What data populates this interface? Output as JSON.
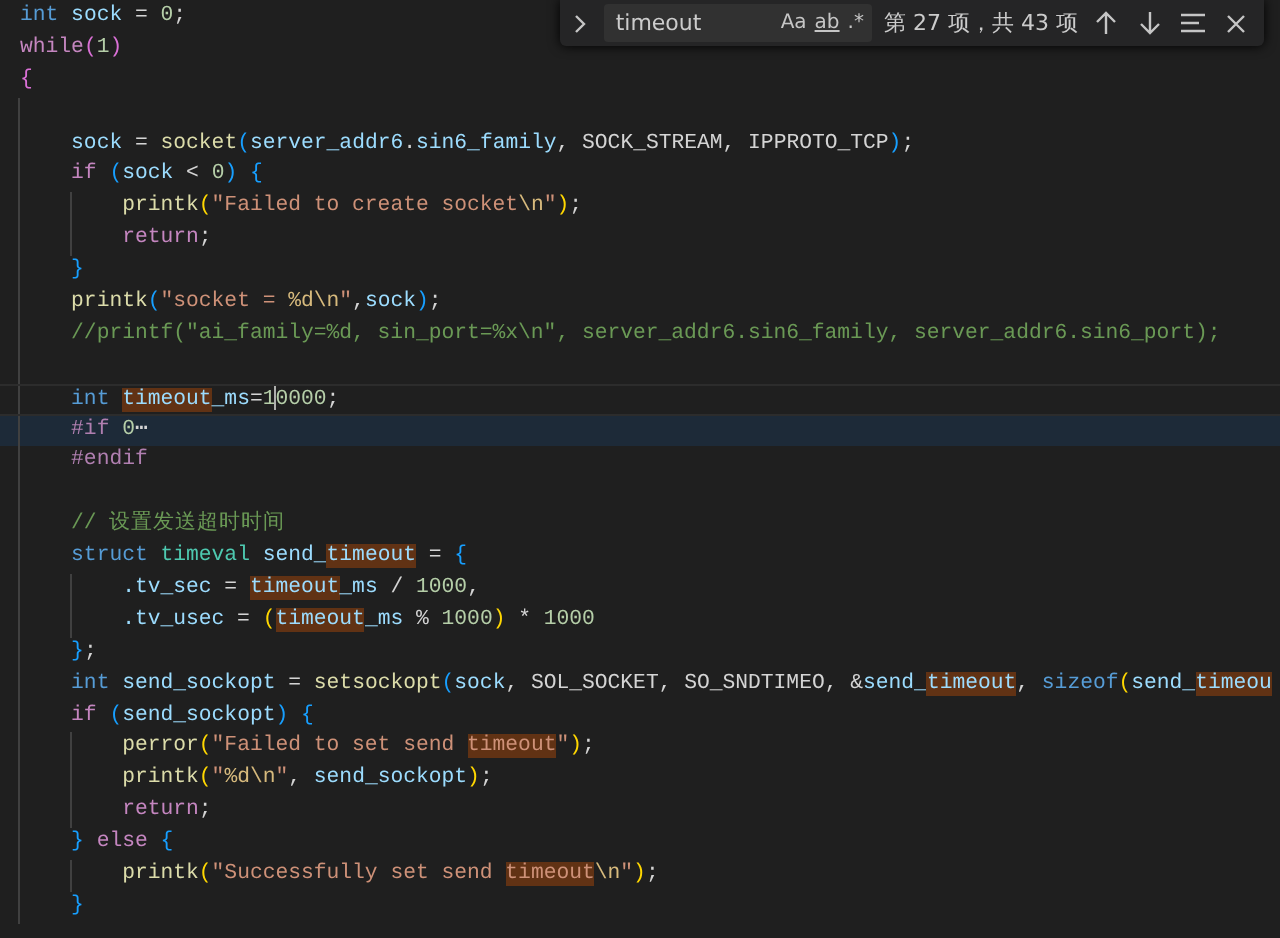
{
  "find_widget": {
    "query": "timeout",
    "options": [
      {
        "text": "Aa",
        "kind": "case"
      },
      {
        "text": "ab",
        "kind": "word"
      },
      {
        "text": ".*",
        "kind": "regex"
      }
    ],
    "result": "第 27 项，共 43 项"
  },
  "code_lines": [
    {
      "kind": "code",
      "tokens": [
        {
          "text": "int",
          "kind": "kw"
        },
        {
          "text": " sock",
          "kind": "var"
        },
        {
          "text": " = ",
          "kind": "plain"
        },
        {
          "text": "0",
          "kind": "num"
        },
        {
          "text": ";",
          "kind": "plain"
        }
      ]
    },
    {
      "kind": "code",
      "tokens": [
        {
          "text": "while",
          "kind": "ctl"
        },
        {
          "text": "(",
          "kind": "b2"
        },
        {
          "text": "1",
          "kind": "num"
        },
        {
          "text": ")",
          "kind": "b2"
        }
      ]
    },
    {
      "kind": "code",
      "tokens": [
        {
          "text": "{",
          "kind": "b2"
        }
      ]
    },
    {
      "kind": "blank"
    },
    {
      "kind": "code",
      "tokens": [
        {
          "text": "    sock",
          "kind": "var"
        },
        {
          "text": " = ",
          "kind": "plain"
        },
        {
          "text": "socket",
          "kind": "fn"
        },
        {
          "text": "(",
          "kind": "b3"
        },
        {
          "text": "server_addr6",
          "kind": "var"
        },
        {
          "text": ".",
          "kind": "plain"
        },
        {
          "text": "sin6_family",
          "kind": "var"
        },
        {
          "text": ", SOCK_STREAM, IPPROTO_TCP",
          "kind": "plain"
        },
        {
          "text": ")",
          "kind": "b3"
        },
        {
          "text": ";",
          "kind": "plain"
        }
      ]
    },
    {
      "kind": "code",
      "tokens": [
        {
          "text": "    if ",
          "kind": "ctl"
        },
        {
          "text": "(",
          "kind": "b3"
        },
        {
          "text": "sock",
          "kind": "var"
        },
        {
          "text": " < ",
          "kind": "plain"
        },
        {
          "text": "0",
          "kind": "num"
        },
        {
          "text": ")",
          "kind": "b3"
        },
        {
          "text": " {",
          "kind": "b3"
        }
      ]
    },
    {
      "kind": "code",
      "tokens": [
        {
          "text": "        printk",
          "kind": "fn"
        },
        {
          "text": "(",
          "kind": "b1"
        },
        {
          "text": "\"Failed to create socket",
          "kind": "str"
        },
        {
          "text": "\\n",
          "kind": "esc"
        },
        {
          "text": "\"",
          "kind": "str"
        },
        {
          "text": ")",
          "kind": "b1"
        },
        {
          "text": ";",
          "kind": "plain"
        }
      ]
    },
    {
      "kind": "code",
      "tokens": [
        {
          "text": "        return",
          "kind": "ctl"
        },
        {
          "text": ";",
          "kind": "plain"
        }
      ]
    },
    {
      "kind": "code",
      "tokens": [
        {
          "text": "    }",
          "kind": "b3"
        }
      ]
    },
    {
      "kind": "code",
      "tokens": [
        {
          "text": "    printk",
          "kind": "fn"
        },
        {
          "text": "(",
          "kind": "b3"
        },
        {
          "text": "\"socket = ",
          "kind": "str"
        },
        {
          "text": "%d\\n",
          "kind": "esc"
        },
        {
          "text": "\"",
          "kind": "str"
        },
        {
          "text": ",",
          "kind": "plain"
        },
        {
          "text": "sock",
          "kind": "var"
        },
        {
          "text": ")",
          "kind": "b3"
        },
        {
          "text": ";",
          "kind": "plain"
        }
      ]
    },
    {
      "kind": "code",
      "tokens": [
        {
          "text": "    //printf(\"ai_family=%d, sin_port=%x\\n\", server_addr6.sin6_family, server_addr6.sin6_port);",
          "kind": "cmt"
        }
      ]
    },
    {
      "kind": "blank"
    },
    {
      "kind": "current",
      "tokens": [
        {
          "text": "    int ",
          "kind": "kw"
        },
        {
          "text": "timeout",
          "kind": "match"
        },
        {
          "text": "_ms",
          "kind": "var"
        },
        {
          "text": "=",
          "kind": "plain"
        },
        {
          "text": "1",
          "kind": "num"
        },
        {
          "kind": "caret"
        },
        {
          "text": "0000",
          "kind": "num"
        },
        {
          "text": ";",
          "kind": "plain"
        }
      ]
    },
    {
      "kind": "folded",
      "tokens": [
        {
          "text": "    #if ",
          "kind": "pre"
        },
        {
          "text": "0",
          "kind": "num"
        },
        {
          "text": "⋯",
          "kind": "plain"
        }
      ]
    },
    {
      "kind": "code",
      "tokens": [
        {
          "text": "    #endif",
          "kind": "pre"
        }
      ]
    },
    {
      "kind": "blank"
    },
    {
      "kind": "code",
      "tokens": [
        {
          "text": "    // 设置发送超时时间",
          "kind": "cmt"
        }
      ]
    },
    {
      "kind": "code",
      "tokens": [
        {
          "text": "    struct ",
          "kind": "kw"
        },
        {
          "text": "timeval",
          "kind": "type"
        },
        {
          "text": " send_",
          "kind": "var"
        },
        {
          "text": "timeout",
          "kind": "match"
        },
        {
          "text": " = ",
          "kind": "plain"
        },
        {
          "text": "{",
          "kind": "b3"
        }
      ]
    },
    {
      "kind": "code",
      "tokens": [
        {
          "text": "        .tv_sec",
          "kind": "var"
        },
        {
          "text": " = ",
          "kind": "plain"
        },
        {
          "text": "timeout",
          "kind": "match"
        },
        {
          "text": "_ms",
          "kind": "var"
        },
        {
          "text": " / ",
          "kind": "plain"
        },
        {
          "text": "1000",
          "kind": "num"
        },
        {
          "text": ",",
          "kind": "plain"
        }
      ]
    },
    {
      "kind": "code",
      "tokens": [
        {
          "text": "        .tv_usec",
          "kind": "var"
        },
        {
          "text": " = ",
          "kind": "plain"
        },
        {
          "text": "(",
          "kind": "b1"
        },
        {
          "text": "timeout",
          "kind": "match"
        },
        {
          "text": "_ms",
          "kind": "var"
        },
        {
          "text": " % ",
          "kind": "plain"
        },
        {
          "text": "1000",
          "kind": "num"
        },
        {
          "text": ")",
          "kind": "b1"
        },
        {
          "text": " * ",
          "kind": "plain"
        },
        {
          "text": "1000",
          "kind": "num"
        }
      ]
    },
    {
      "kind": "code",
      "tokens": [
        {
          "text": "    }",
          "kind": "b3"
        },
        {
          "text": ";",
          "kind": "plain"
        }
      ]
    },
    {
      "kind": "code",
      "tokens": [
        {
          "text": "    int ",
          "kind": "kw"
        },
        {
          "text": "send_sockopt",
          "kind": "var"
        },
        {
          "text": " = ",
          "kind": "plain"
        },
        {
          "text": "setsockopt",
          "kind": "fn"
        },
        {
          "text": "(",
          "kind": "b3"
        },
        {
          "text": "sock",
          "kind": "var"
        },
        {
          "text": ", SOL_SOCKET, SO_SNDTIMEO, &",
          "kind": "plain"
        },
        {
          "text": "send_",
          "kind": "var"
        },
        {
          "text": "timeout",
          "kind": "match"
        },
        {
          "text": ", ",
          "kind": "plain"
        },
        {
          "text": "sizeof",
          "kind": "kw"
        },
        {
          "text": "(",
          "kind": "b1"
        },
        {
          "text": "send_",
          "kind": "var"
        },
        {
          "text": "timeou",
          "kind": "match"
        }
      ]
    },
    {
      "kind": "code",
      "tokens": [
        {
          "text": "    if ",
          "kind": "ctl"
        },
        {
          "text": "(",
          "kind": "b3"
        },
        {
          "text": "send_sockopt",
          "kind": "var"
        },
        {
          "text": ")",
          "kind": "b3"
        },
        {
          "text": " {",
          "kind": "b3"
        }
      ]
    },
    {
      "kind": "code",
      "tokens": [
        {
          "text": "        perror",
          "kind": "fn"
        },
        {
          "text": "(",
          "kind": "b1"
        },
        {
          "text": "\"Failed to set send ",
          "kind": "str"
        },
        {
          "text": "timeout",
          "kind": "match_str"
        },
        {
          "text": "\"",
          "kind": "str"
        },
        {
          "text": ")",
          "kind": "b1"
        },
        {
          "text": ";",
          "kind": "plain"
        }
      ]
    },
    {
      "kind": "code",
      "tokens": [
        {
          "text": "        printk",
          "kind": "fn"
        },
        {
          "text": "(",
          "kind": "b1"
        },
        {
          "text": "\"",
          "kind": "str"
        },
        {
          "text": "%d\\n",
          "kind": "esc"
        },
        {
          "text": "\"",
          "kind": "str"
        },
        {
          "text": ", ",
          "kind": "plain"
        },
        {
          "text": "send_sockopt",
          "kind": "var"
        },
        {
          "text": ")",
          "kind": "b1"
        },
        {
          "text": ";",
          "kind": "plain"
        }
      ]
    },
    {
      "kind": "code",
      "tokens": [
        {
          "text": "        return",
          "kind": "ctl"
        },
        {
          "text": ";",
          "kind": "plain"
        }
      ]
    },
    {
      "kind": "code",
      "tokens": [
        {
          "text": "    }",
          "kind": "b3"
        },
        {
          "text": " else ",
          "kind": "ctl"
        },
        {
          "text": "{",
          "kind": "b3"
        }
      ]
    },
    {
      "kind": "code",
      "tokens": [
        {
          "text": "        printk",
          "kind": "fn"
        },
        {
          "text": "(",
          "kind": "b1"
        },
        {
          "text": "\"Successfully set send ",
          "kind": "str"
        },
        {
          "text": "timeout",
          "kind": "match_str"
        },
        {
          "text": "\\n",
          "kind": "esc"
        },
        {
          "text": "\"",
          "kind": "str"
        },
        {
          "text": ")",
          "kind": "b1"
        },
        {
          "text": ";",
          "kind": "plain"
        }
      ]
    },
    {
      "kind": "code",
      "tokens": [
        {
          "text": "    }",
          "kind": "b3"
        }
      ]
    }
  ]
}
